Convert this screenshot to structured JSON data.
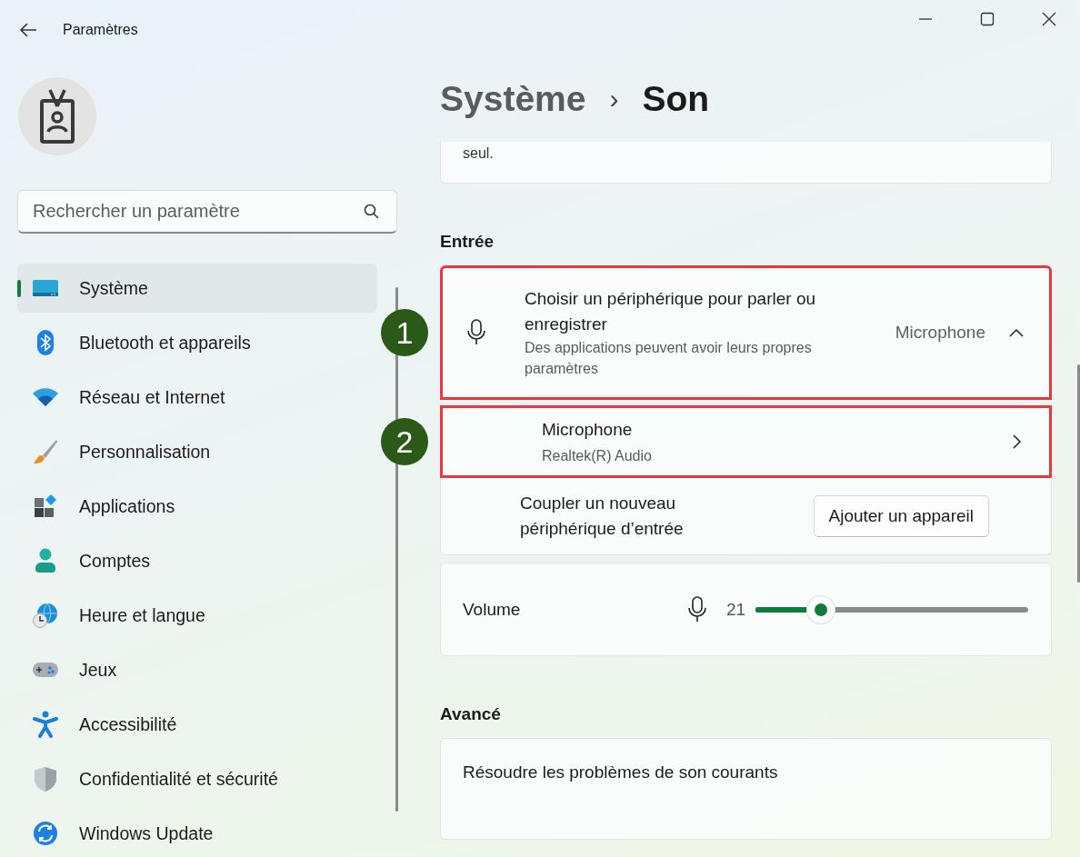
{
  "window": {
    "title": "Paramètres"
  },
  "sidebar": {
    "search": {
      "placeholder": "Rechercher un paramètre"
    },
    "items": [
      {
        "label": "Système",
        "selected": true
      },
      {
        "label": "Bluetooth et appareils",
        "selected": false
      },
      {
        "label": "Réseau et Internet",
        "selected": false
      },
      {
        "label": "Personnalisation",
        "selected": false
      },
      {
        "label": "Applications",
        "selected": false
      },
      {
        "label": "Comptes",
        "selected": false
      },
      {
        "label": "Heure et langue",
        "selected": false
      },
      {
        "label": "Jeux",
        "selected": false
      },
      {
        "label": "Accessibilité",
        "selected": false
      },
      {
        "label": "Confidentialité et sécurité",
        "selected": false
      },
      {
        "label": "Windows Update",
        "selected": false
      }
    ]
  },
  "breadcrumb": {
    "parent": "Système",
    "separator": "›",
    "current": "Son"
  },
  "top_card": {
    "text": "seul."
  },
  "input_section": {
    "heading": "Entrée",
    "device_picker": {
      "title": "Choisir un périphérique pour parler ou enregistrer",
      "subtitle": "Des applications peuvent avoir leurs propres paramètres",
      "value": "Microphone",
      "expanded": true,
      "highlighted": true,
      "marker": "1"
    },
    "devices": [
      {
        "name": "Microphone",
        "detail": "Realtek(R) Audio",
        "highlighted": true,
        "marker": "2"
      }
    ],
    "pair": {
      "label": "Coupler un nouveau périphérique d’entrée",
      "button": "Ajouter un appareil"
    },
    "volume": {
      "label": "Volume",
      "reading": "21",
      "level": 0.24
    }
  },
  "advanced": {
    "heading": "Avancé",
    "items": [
      {
        "label": "Résoudre les problèmes de son courants"
      }
    ]
  }
}
